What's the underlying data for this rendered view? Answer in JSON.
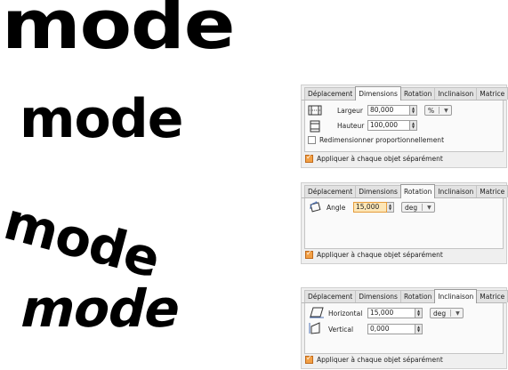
{
  "words": {
    "w1": "mode",
    "w2": "mode",
    "w3": "mode",
    "w4": "mode"
  },
  "tab_labels": [
    "Déplacement",
    "Dimensions",
    "Rotation",
    "Inclinaison",
    "Matrice"
  ],
  "footer_label": "Appliquer à chaque objet séparément",
  "panel_dimensions": {
    "active_tab": "Dimensions",
    "width_label": "Largeur",
    "width_value": "80,000",
    "height_label": "Hauteur",
    "height_value": "100,000",
    "unit": "%",
    "proportional_label": "Redimensionner proportionnellement",
    "proportional_checked": false,
    "apply_each_checked": true
  },
  "panel_rotation": {
    "active_tab": "Rotation",
    "angle_label": "Angle",
    "angle_value": "15,000",
    "unit": "deg",
    "apply_each_checked": true
  },
  "panel_skew": {
    "active_tab": "Inclinaison",
    "horizontal_label": "Horizontal",
    "horizontal_value": "15,000",
    "vertical_label": "Vertical",
    "vertical_value": "0,000",
    "unit": "deg",
    "apply_each_checked": true
  }
}
